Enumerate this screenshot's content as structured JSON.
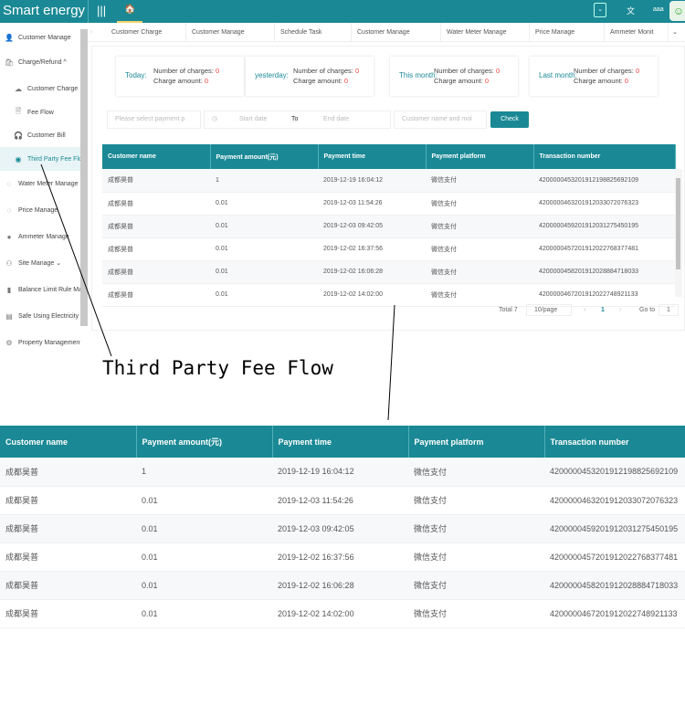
{
  "header": {
    "brand": "Smart energy",
    "user": "aaa"
  },
  "sidebar": [
    {
      "label": "Customer Manage",
      "icon": "user-icon"
    },
    {
      "label": "Charge/Refund ^",
      "icon": "bag-icon"
    },
    {
      "label": "Customer Charge",
      "icon": "cloud-icon",
      "sub": true
    },
    {
      "label": "Fee Flow",
      "icon": "document-icon",
      "sub": true
    },
    {
      "label": "Customer Bill",
      "icon": "headset-icon",
      "sub": true
    },
    {
      "label": "Third Party Fee Flow",
      "icon": "location-icon",
      "sub": true,
      "active": true
    },
    {
      "label": "Water Meter Manage",
      "icon": "globe-icon"
    },
    {
      "label": "Price Manage",
      "icon": "globe-icon"
    },
    {
      "label": "Ammeter Manage",
      "icon": "info-icon"
    },
    {
      "label": "Site Manage  ⌄",
      "icon": "person-icon"
    },
    {
      "label": "Balance Limit Rule Manage",
      "icon": "chart-icon"
    },
    {
      "label": "Safe Using Electricity",
      "icon": "clipboard-icon"
    },
    {
      "label": "Property Management",
      "icon": "gear-icon"
    }
  ],
  "tabs": [
    "Customer Charge",
    "Customer Manage",
    "Schedule Task",
    "Customer Manage",
    "Water Meter Manage",
    "Price Manage",
    "Ammeter Monit"
  ],
  "cards": [
    {
      "label": "Today:",
      "charges_label": "Number of charges:",
      "charges": "0",
      "amount_label": "Charge amount:",
      "amount": "0"
    },
    {
      "label": "yesterday:",
      "charges_label": "Number of charges:",
      "charges": "0",
      "amount_label": "Charge amount:",
      "amount": "0"
    },
    {
      "label": "This month:",
      "charges_label": "Number of charges:",
      "charges": "0",
      "amount_label": "Charge amount:",
      "amount": "0"
    },
    {
      "label": "Last month:",
      "charges_label": "Number of charges:",
      "charges": "0",
      "amount_label": "Charge amount:",
      "amount": "0"
    }
  ],
  "filters": {
    "payment_placeholder": "Please select payment p",
    "start": "Start date",
    "to": "To",
    "end": "End date",
    "customer_placeholder": "Customer name and mol",
    "check": "Check"
  },
  "table": {
    "columns": [
      "Customer name",
      "Payment amount(元)",
      "Payment time",
      "Payment platform",
      "Transaction number"
    ],
    "rows": [
      [
        "成都昊普",
        "1",
        "2019-12-19 16:04:12",
        "微信支付",
        "4200000453201912198825692109"
      ],
      [
        "成都昊普",
        "0.01",
        "2019-12-03 11:54:26",
        "微信支付",
        "4200000463201912033072076323"
      ],
      [
        "成都昊普",
        "0.01",
        "2019-12-03 09:42:05",
        "微信支付",
        "4200000459201912031275450195"
      ],
      [
        "成都昊普",
        "0.01",
        "2019-12-02 16:37:56",
        "微信支付",
        "4200000457201912022768377481"
      ],
      [
        "成都昊普",
        "0.01",
        "2019-12-02 16:06:28",
        "微信支付",
        "4200000458201912028884718033"
      ],
      [
        "成都昊普",
        "0.01",
        "2019-12-02 14:02:00",
        "微信支付",
        "4200000467201912022748921133"
      ]
    ]
  },
  "pagination": {
    "total": "Total 7",
    "page_size": "10/page",
    "current": "1",
    "goto_label": "Go to",
    "goto_value": "1"
  },
  "annotation": "Third Party Fee Flow"
}
